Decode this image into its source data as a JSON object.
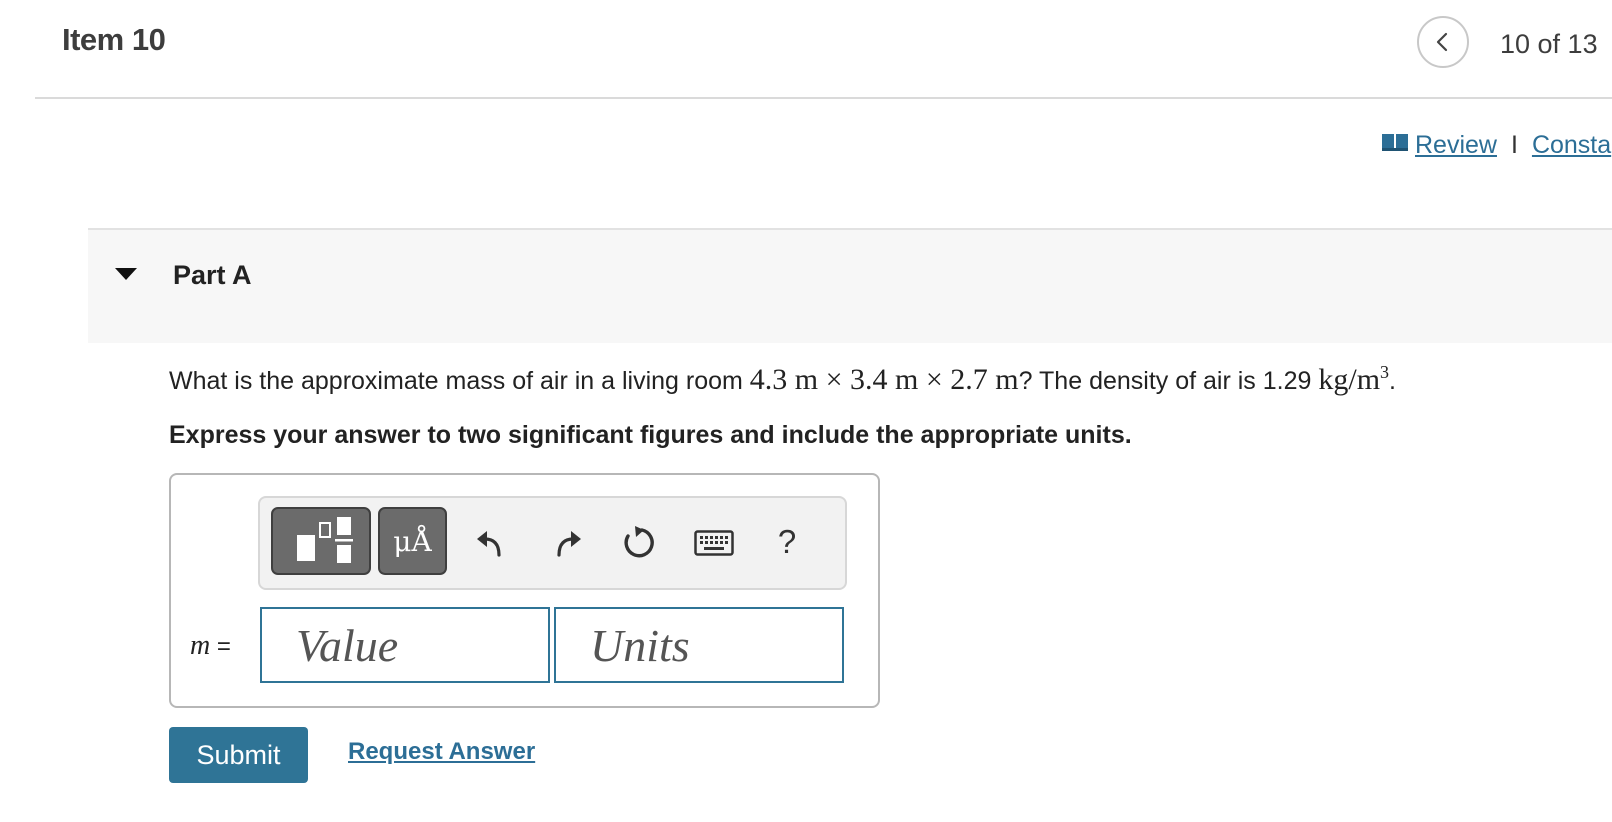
{
  "header": {
    "item_title": "Item 10",
    "counter": "10 of 13"
  },
  "links": {
    "review": "Review",
    "separator": "I",
    "constants": "Consta"
  },
  "part": {
    "label": "Part A"
  },
  "question": {
    "prefix": "What is the approximate mass of air in a living room ",
    "dimensions": "4.3 m × 3.4 m × 2.7 m",
    "middle": "? The density of air is 1.29 ",
    "density_unit": "kg/m",
    "density_exp": "3",
    "suffix": ".",
    "instruction": "Express your answer to two significant figures and include the appropriate units."
  },
  "toolbar": {
    "symbols_label": "μÅ",
    "help_label": "?"
  },
  "answer": {
    "variable": "m",
    "equals": "=",
    "value_placeholder": "Value",
    "units_placeholder": "Units"
  },
  "actions": {
    "submit_label": "Submit",
    "request_answer_label": "Request Answer"
  },
  "colors": {
    "accent": "#2f7496",
    "link": "#2c6e96",
    "toolbar_button": "#6b6b6b"
  },
  "icons": {
    "prev": "chevron-left-icon",
    "review": "book-icon",
    "part_toggle": "caret-down-icon",
    "templates": "templates-icon",
    "undo": "undo-icon",
    "redo": "redo-icon",
    "reset": "reset-icon",
    "keyboard": "keyboard-icon"
  }
}
